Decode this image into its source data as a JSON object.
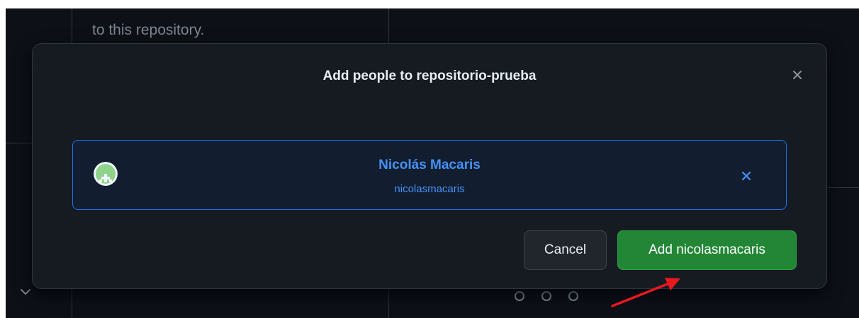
{
  "background": {
    "text": "to this repository."
  },
  "dialog": {
    "title": "Add people to repositorio-prueba",
    "close_icon": "close-icon",
    "selected_user": {
      "name": "Nicolás Macaris",
      "login": "nicolasmacaris",
      "remove_icon": "close-icon"
    },
    "cancel_label": "Cancel",
    "add_label": "Add nicolasmacaris"
  },
  "colors": {
    "background": "#0d1117",
    "dialog": "#161b22",
    "accent_blue": "#4493f8",
    "primary_green": "#238636",
    "annotation_red": "#e8191e"
  }
}
